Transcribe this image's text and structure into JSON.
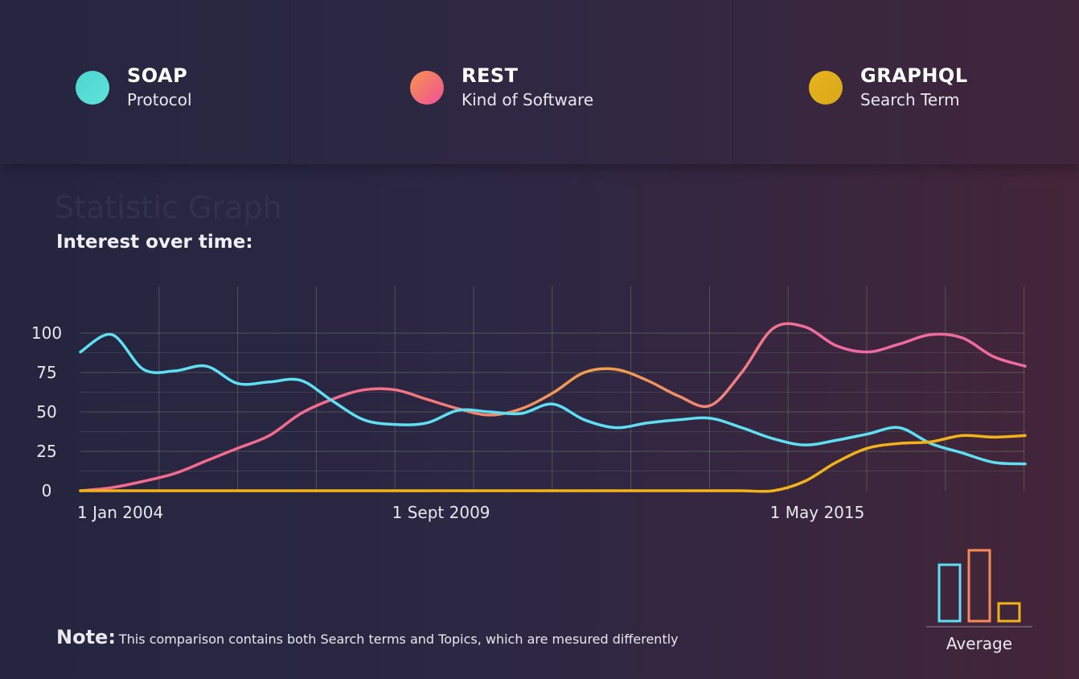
{
  "legend": {
    "items": [
      {
        "name": "SOAP",
        "subtitle": "Protocol",
        "colors": [
          "#4ed5cf",
          "#5fe3dc"
        ]
      },
      {
        "name": "REST",
        "subtitle": "Kind of Software",
        "colors": [
          "#f7954f",
          "#f04f96"
        ]
      },
      {
        "name": "GRAPHQL",
        "subtitle": "Search Term",
        "colors": [
          "#e8b51e",
          "#d9a61a"
        ]
      }
    ]
  },
  "ghost_title": "Statistic Graph",
  "heading": "Interest over time:",
  "note": {
    "label": "Note:",
    "text": "This comparison contains both Search terms and Topics, which are mesured differently"
  },
  "average": {
    "label": "Average"
  },
  "chart_data": [
    {
      "type": "line",
      "title": "",
      "xlabel": "",
      "ylabel": "",
      "x_tick_labels": [
        "1 Jan 2004",
        "1 Sept 2009",
        "1 May 2015"
      ],
      "x_tick_positions": [
        0,
        10,
        22
      ],
      "y_ticks": [
        0,
        25,
        50,
        75,
        100
      ],
      "ylim": [
        0,
        100
      ],
      "xlim": [
        0,
        30
      ],
      "grid": true,
      "x": [
        0,
        1,
        2,
        3,
        4,
        5,
        6,
        7,
        8,
        9,
        10,
        11,
        12,
        13,
        14,
        15,
        16,
        17,
        18,
        19,
        20,
        21,
        22,
        23,
        24,
        25,
        26,
        27,
        28,
        29,
        30
      ],
      "series": [
        {
          "name": "SOAP",
          "color": "#5fe0f2",
          "values": [
            88,
            99,
            77,
            76,
            79,
            68,
            69,
            70,
            57,
            45,
            42,
            43,
            51,
            50,
            49,
            55,
            45,
            40,
            43,
            45,
            46,
            40,
            33,
            29,
            32,
            36,
            40,
            30,
            24,
            18,
            17
          ]
        },
        {
          "name": "REST",
          "gradient": [
            "#f56b8e",
            "#f2a049",
            "#f06aa0"
          ],
          "values": [
            0,
            2,
            6,
            11,
            19,
            27,
            35,
            49,
            58,
            64,
            64,
            58,
            52,
            48,
            52,
            62,
            75,
            77,
            70,
            60,
            54,
            75,
            103,
            104,
            92,
            88,
            93,
            99,
            97,
            85,
            79
          ]
        },
        {
          "name": "GRAPHQL",
          "color": "#f2b21a",
          "values": [
            0,
            0,
            0,
            0,
            0,
            0,
            0,
            0,
            0,
            0,
            0,
            0,
            0,
            0,
            0,
            0,
            0,
            0,
            0,
            0,
            0,
            0,
            0,
            6,
            18,
            27,
            30,
            31,
            35,
            34,
            35
          ]
        }
      ]
    },
    {
      "type": "bar",
      "title": "Average",
      "categories": [
        "SOAP",
        "REST",
        "GRAPHQL"
      ],
      "values": [
        70,
        88,
        22
      ],
      "colors": [
        "#5fe0f2",
        "#f58a55",
        "#f2b21a"
      ]
    }
  ]
}
